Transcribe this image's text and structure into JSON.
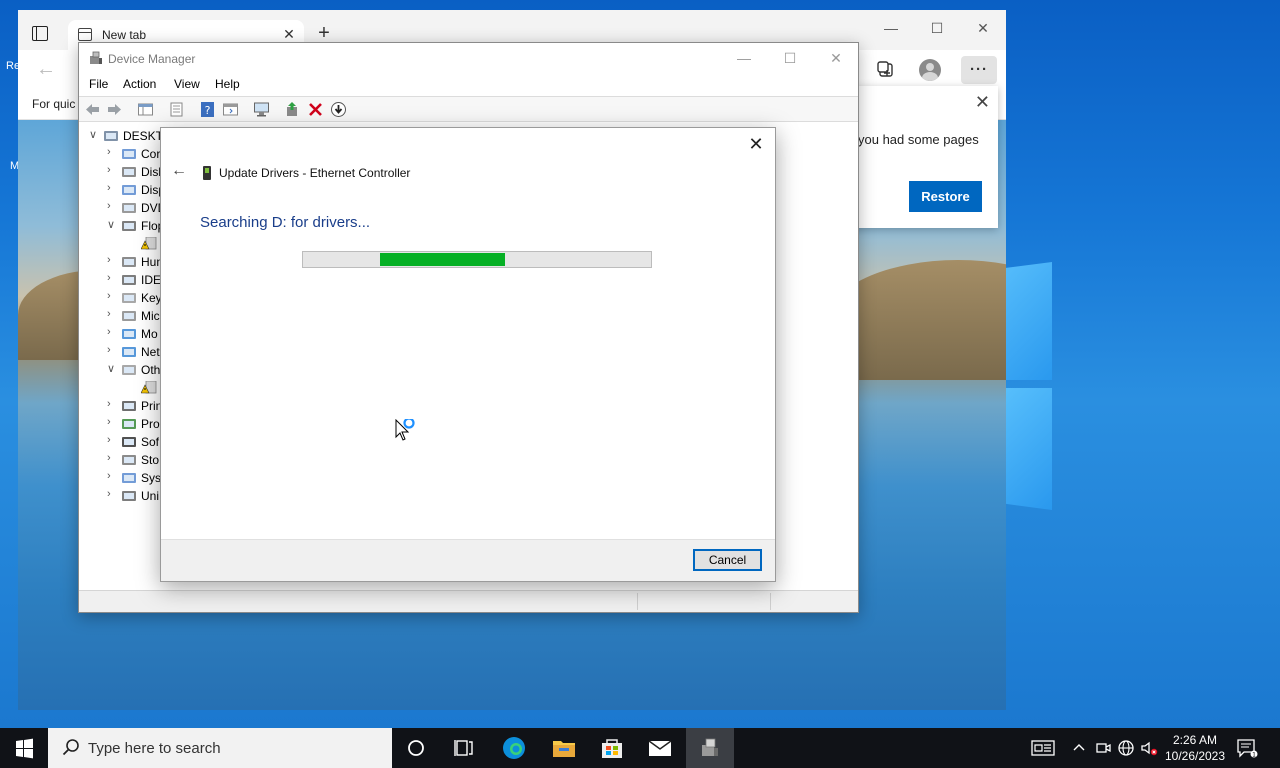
{
  "desktop": {
    "left_icon_text_1": "Re",
    "left_icon_text_2": "M"
  },
  "edge": {
    "tab_title": "New tab",
    "favbar_text": "For quic",
    "popup_text": "you had some pages",
    "restore_label": "Restore"
  },
  "device_manager": {
    "title": "Device Manager",
    "menu": [
      "File",
      "Action",
      "View",
      "Help"
    ],
    "tree": [
      {
        "arrow": "∨",
        "label": "DESKTO",
        "indent": 0
      },
      {
        "arrow": "›",
        "label": "Cor",
        "indent": 1
      },
      {
        "arrow": "›",
        "label": "Disk",
        "indent": 1
      },
      {
        "arrow": "›",
        "label": "Disp",
        "indent": 1
      },
      {
        "arrow": "›",
        "label": "DVD",
        "indent": 1
      },
      {
        "arrow": "∨",
        "label": "Flop",
        "indent": 1
      },
      {
        "arrow": "",
        "label": "",
        "indent": 2
      },
      {
        "arrow": "›",
        "label": "Hun",
        "indent": 1
      },
      {
        "arrow": "›",
        "label": "IDE",
        "indent": 1
      },
      {
        "arrow": "›",
        "label": "Key",
        "indent": 1
      },
      {
        "arrow": "›",
        "label": "Mic",
        "indent": 1
      },
      {
        "arrow": "›",
        "label": "Mo",
        "indent": 1
      },
      {
        "arrow": "›",
        "label": "Net",
        "indent": 1
      },
      {
        "arrow": "∨",
        "label": "Oth",
        "indent": 1
      },
      {
        "arrow": "",
        "label": "",
        "indent": 2
      },
      {
        "arrow": "›",
        "label": "Prin",
        "indent": 1
      },
      {
        "arrow": "›",
        "label": "Pro",
        "indent": 1
      },
      {
        "arrow": "›",
        "label": "Sof",
        "indent": 1
      },
      {
        "arrow": "›",
        "label": "Sto",
        "indent": 1
      },
      {
        "arrow": "›",
        "label": "Syst",
        "indent": 1
      },
      {
        "arrow": "›",
        "label": "Uni",
        "indent": 1
      }
    ]
  },
  "dialog": {
    "header": "Update Drivers - Ethernet Controller",
    "status": "Searching D: for drivers...",
    "progress_start": 0.22,
    "progress_end": 0.58,
    "cancel_label": "Cancel"
  },
  "taskbar": {
    "search_placeholder": "Type here to search",
    "time": "2:26 AM",
    "date": "10/26/2023"
  },
  "colors": {
    "accent": "#0067c0",
    "progress_green": "#06b025",
    "status_blue": "#1a3e8a"
  }
}
